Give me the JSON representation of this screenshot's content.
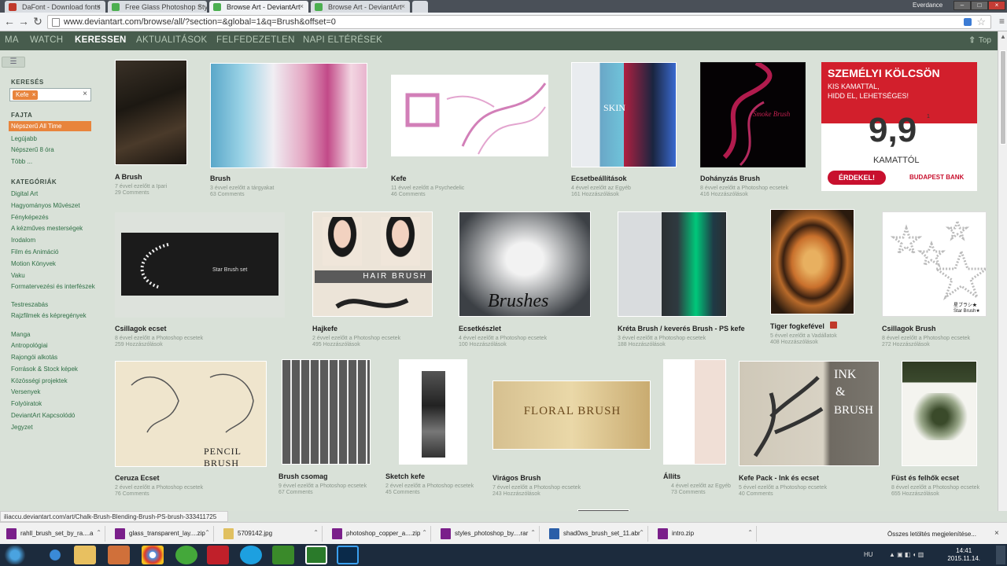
{
  "browser": {
    "tabs": [
      {
        "title": "DaFont - Download fonts",
        "favicon_color": "#c0392b"
      },
      {
        "title": "Free Glass Photoshop Sty",
        "favicon_color": "#4caf50"
      },
      {
        "title": "Browse Art - DeviantArt",
        "favicon_color": "#4caf50"
      },
      {
        "title": "Browse Art - DeviantArt",
        "favicon_color": "#4caf50"
      }
    ],
    "user": "Everdance",
    "url": "www.deviantart.com/browse/all/?section=&global=1&q=Brush&offset=0"
  },
  "da_nav": {
    "items": [
      "MA",
      "WATCH",
      "KERESSEN",
      "AKTUALITÁSOK",
      "FELFEDEZETLEN",
      "NAPI ELTÉRÉSEK"
    ],
    "active": "KERESSEN",
    "top": "Top"
  },
  "sidebar": {
    "search_heading": "KERESÉS",
    "search_chip": "Kefe",
    "sort_heading": "FAJTA",
    "sort_items": [
      "Népszerű All Time",
      "Legújabb",
      "Népszerű 8 óra",
      "Több ..."
    ],
    "categories_heading": "KATEGÓRIÁK",
    "categories": [
      "Digital Art",
      "Hagyományos Művészet",
      "Fényképezés",
      "A kézműves mesterségek",
      "Irodalom",
      "Film és Animáció",
      "Motion Könyvek",
      "Vaku",
      "Formatervezési és interfészek",
      "Testreszabás",
      "Rajzfilmek és képregények",
      "Manga",
      "Antropológiai",
      "Rajongói alkotás",
      "Források & Stock képek",
      "Közösségi projektek",
      "Versenyek",
      "Folyóiratok",
      "DeviantArt Kapcsolódó",
      "Jegyzet"
    ]
  },
  "ad": {
    "line1": "SZEMÉLYI KÖLCSÖN",
    "line2": "KIS KAMATTAL,",
    "line3": "HIDD EL, LEHETSÉGES!",
    "rate": "9,9",
    "sup": "1",
    "rate_label": "KAMATTÓL",
    "button": "ÉRDEKEL!",
    "bank": "BUDAPEST BANK"
  },
  "items": [
    {
      "title": "A Brush",
      "meta": "7 évvel ezelőtt a Ipari",
      "comments": "29 Comments"
    },
    {
      "title": "Brush",
      "meta": "3 évvel ezelőtt a tárgyakat",
      "comments": "63 Comments"
    },
    {
      "title": "Kefe",
      "meta": "11 évvel ezelőtt a Psychedelic",
      "comments": "46 Comments"
    },
    {
      "title": "Ecsetbeállítások",
      "meta": "4 évvel ezelőtt az Egyéb",
      "comments": "161 Hozzászólások"
    },
    {
      "title": "Dohányzás Brush",
      "meta": "8 évvel ezelőtt a Photoshop ecsetek",
      "comments": "416 Hozzászólások"
    },
    {
      "title": "Csillagok ecset",
      "meta": "8 évvel ezelőtt a Photoshop ecsetek",
      "comments": "259 Hozzászólások"
    },
    {
      "title": "Hajkefe",
      "meta": "2 évvel ezelőtt a Photoshop ecsetek",
      "comments": "495 Hozzászólások"
    },
    {
      "title": "Ecsetkészlet",
      "meta": "4 évvel ezelőtt a Photoshop ecsetek",
      "comments": "100 Hozzászólások"
    },
    {
      "title": "Kréta Brush / keverés Brush - PS kefe",
      "meta": "3 évvel ezelőtt a Photoshop ecsetek",
      "comments": "188 Hozzászólások"
    },
    {
      "title": "Tiger fogkefével",
      "meta": "5 évvel ezelőtt a Vadállatok",
      "comments": "408 Hozzászólások"
    },
    {
      "title": "Csillagok Brush",
      "meta": "8 évvel ezelőtt a Photoshop ecsetek",
      "comments": "272 Hozzászólások"
    },
    {
      "title": "Ceruza Ecset",
      "meta": "2 évvel ezelőtt a Photoshop ecsetek",
      "comments": "76 Comments"
    },
    {
      "title": "Brush csomag",
      "meta": "9 évvel ezelőtt a Photoshop ecsetek",
      "comments": "67 Comments"
    },
    {
      "title": "Sketch kefe",
      "meta": "2 évvel ezelőtt a Photoshop ecsetek",
      "comments": "45 Comments"
    },
    {
      "title": "Virágos Brush",
      "meta": "7 évvel ezelőtt a Photoshop ecsetek",
      "comments": "243 Hozzászólások"
    },
    {
      "title": "Állíts",
      "meta": "4 évvel ezelőtt az Egyéb",
      "comments": "73 Comments"
    },
    {
      "title": "Kefe Pack - Ink és ecset",
      "meta": "5 évvel ezelőtt a Photoshop ecsetek",
      "comments": "40 Comments"
    },
    {
      "title": "Füst és felhők ecset",
      "meta": "8 évvel ezelőtt a Photoshop ecsetek",
      "comments": "655 Hozzászólások"
    }
  ],
  "thumb_text": {
    "star_brush": "Star Brush set",
    "hair": "HAIR BRUSH",
    "brushes": "Brushes",
    "pencil": "PENCIL BRUSH",
    "floral": "FLORAL BRUSH",
    "ink1": "INK",
    "ink2": "&",
    "ink3": "BRUSH",
    "smoke": "Smoke Brush",
    "skin": "SKIN",
    "star_jp": "星ブラシ★ Star Brush★"
  },
  "status_url": "iliaccu.deviantart.com/art/Chalk-Brush-Blending-Brush-PS-brush-333411725",
  "downloads": [
    "rahll_brush_set_by_ra....a",
    "glass_transparent_lay....zip",
    "5709142.jpg",
    "photoshop_copper_a....zip",
    "styles_photoshop_by....rar",
    "shad0ws_brush_set_11.abr",
    "intro.zip"
  ],
  "download_all": "Összes letöltés megjelenítése...",
  "clock": {
    "time": "14:41",
    "date": "2015.11.14."
  },
  "lang": "HU"
}
